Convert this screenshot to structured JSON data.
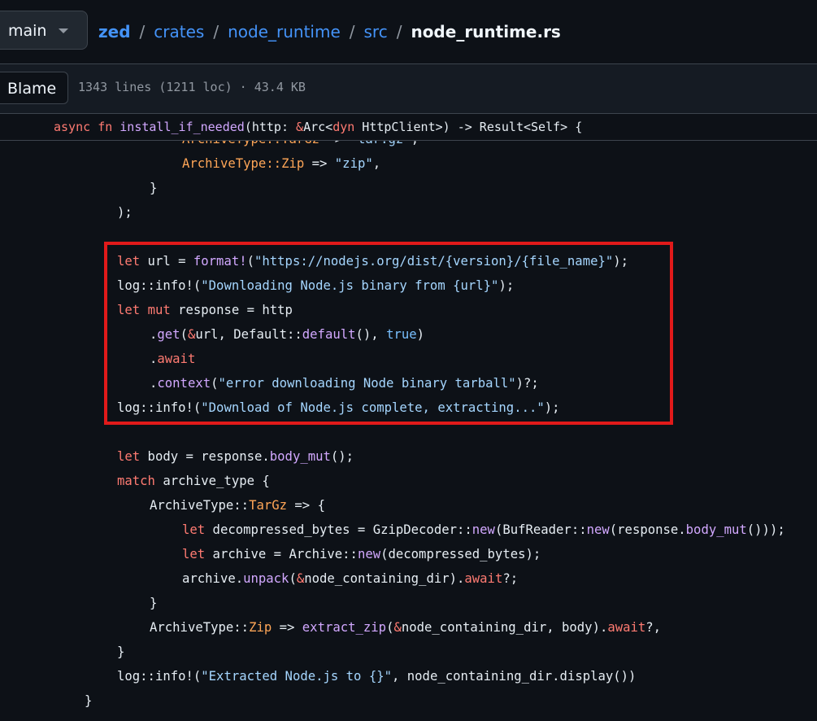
{
  "header": {
    "branch": "main",
    "breadcrumb": [
      "zed",
      "crates",
      "node_runtime",
      "src"
    ],
    "separator": "/",
    "current_file": "node_runtime.rs"
  },
  "infobar": {
    "blame_label": "Blame",
    "file_meta": "1343 lines (1211 loc) · 43.4 KB"
  },
  "code": {
    "sticky_header": [
      {
        "t": "async",
        "c": "kw"
      },
      {
        "t": " "
      },
      {
        "t": "fn",
        "c": "kw"
      },
      {
        "t": " "
      },
      {
        "t": "install_if_needed",
        "c": "fn"
      },
      {
        "t": "(http: "
      },
      {
        "t": "&",
        "c": "kw"
      },
      {
        "t": "Arc<"
      },
      {
        "t": "dyn",
        "c": "kw"
      },
      {
        "t": " HttpClient>) -> Result<Self> {"
      }
    ],
    "lines": [
      {
        "indent": 56,
        "spans": [
          {
            "t": "ArchiveType::",
            "c": "ty"
          },
          {
            "t": "TarGz",
            "c": "ty"
          },
          {
            "t": " => "
          },
          {
            "t": "\"tar.gz\"",
            "c": "str"
          },
          {
            "t": ","
          }
        ]
      },
      {
        "indent": 56,
        "spans": [
          {
            "t": "ArchiveType::",
            "c": "ty"
          },
          {
            "t": "Zip",
            "c": "ty"
          },
          {
            "t": " => "
          },
          {
            "t": "\"zip\"",
            "c": "str"
          },
          {
            "t": ","
          }
        ]
      },
      {
        "indent": 46,
        "spans": [
          {
            "t": "}"
          }
        ]
      },
      {
        "indent": 36,
        "spans": [
          {
            "t": ");"
          }
        ]
      },
      {
        "indent": 0,
        "spans": []
      },
      {
        "indent": 36,
        "spans": [
          {
            "t": "let",
            "c": "kw"
          },
          {
            "t": " url = "
          },
          {
            "t": "format!",
            "c": "fn"
          },
          {
            "t": "("
          },
          {
            "t": "\"https://nodejs.org/dist/{version}/{file_name}\"",
            "c": "str"
          },
          {
            "t": ");"
          }
        ]
      },
      {
        "indent": 36,
        "spans": [
          {
            "t": "log::info!("
          },
          {
            "t": "\"Downloading Node.js binary from {url}\"",
            "c": "str"
          },
          {
            "t": ");"
          }
        ]
      },
      {
        "indent": 36,
        "spans": [
          {
            "t": "let",
            "c": "kw"
          },
          {
            "t": " "
          },
          {
            "t": "mut",
            "c": "kw"
          },
          {
            "t": " response = http"
          }
        ]
      },
      {
        "indent": 46,
        "spans": [
          {
            "t": "."
          },
          {
            "t": "get",
            "c": "fn"
          },
          {
            "t": "("
          },
          {
            "t": "&",
            "c": "kw"
          },
          {
            "t": "url, Default::"
          },
          {
            "t": "default",
            "c": "fn"
          },
          {
            "t": "(), "
          },
          {
            "t": "true",
            "c": "lit"
          },
          {
            "t": ")"
          }
        ]
      },
      {
        "indent": 46,
        "spans": [
          {
            "t": "."
          },
          {
            "t": "await",
            "c": "kw"
          }
        ]
      },
      {
        "indent": 46,
        "spans": [
          {
            "t": "."
          },
          {
            "t": "context",
            "c": "fn"
          },
          {
            "t": "("
          },
          {
            "t": "\"error downloading Node binary tarball\"",
            "c": "str"
          },
          {
            "t": ")?;"
          }
        ]
      },
      {
        "indent": 36,
        "spans": [
          {
            "t": "log::info!("
          },
          {
            "t": "\"Download of Node.js complete, extracting...\"",
            "c": "str"
          },
          {
            "t": ");"
          }
        ]
      },
      {
        "indent": 0,
        "spans": []
      },
      {
        "indent": 36,
        "spans": [
          {
            "t": "let",
            "c": "kw"
          },
          {
            "t": " body = response."
          },
          {
            "t": "body_mut",
            "c": "fn"
          },
          {
            "t": "();"
          }
        ]
      },
      {
        "indent": 36,
        "spans": [
          {
            "t": "match",
            "c": "kw"
          },
          {
            "t": " archive_type {"
          }
        ]
      },
      {
        "indent": 46,
        "spans": [
          {
            "t": "ArchiveType::"
          },
          {
            "t": "TarGz",
            "c": "ty"
          },
          {
            "t": " => {"
          }
        ]
      },
      {
        "indent": 56,
        "spans": [
          {
            "t": "let",
            "c": "kw"
          },
          {
            "t": " decompressed_bytes = GzipDecoder::"
          },
          {
            "t": "new",
            "c": "fn"
          },
          {
            "t": "(BufReader::"
          },
          {
            "t": "new",
            "c": "fn"
          },
          {
            "t": "(response."
          },
          {
            "t": "body_mut",
            "c": "fn"
          },
          {
            "t": "()));"
          }
        ]
      },
      {
        "indent": 56,
        "spans": [
          {
            "t": "let",
            "c": "kw"
          },
          {
            "t": " archive = Archive::"
          },
          {
            "t": "new",
            "c": "fn"
          },
          {
            "t": "(decompressed_bytes);"
          }
        ]
      },
      {
        "indent": 56,
        "spans": [
          {
            "t": "archive."
          },
          {
            "t": "unpack",
            "c": "fn"
          },
          {
            "t": "("
          },
          {
            "t": "&",
            "c": "kw"
          },
          {
            "t": "node_containing_dir)."
          },
          {
            "t": "await",
            "c": "kw"
          },
          {
            "t": "?;"
          }
        ]
      },
      {
        "indent": 46,
        "spans": [
          {
            "t": "}"
          }
        ]
      },
      {
        "indent": 46,
        "spans": [
          {
            "t": "ArchiveType::"
          },
          {
            "t": "Zip",
            "c": "ty"
          },
          {
            "t": " => "
          },
          {
            "t": "extract_zip",
            "c": "fn"
          },
          {
            "t": "("
          },
          {
            "t": "&",
            "c": "kw"
          },
          {
            "t": "node_containing_dir, body)."
          },
          {
            "t": "await",
            "c": "kw"
          },
          {
            "t": "?,"
          }
        ]
      },
      {
        "indent": 36,
        "spans": [
          {
            "t": "}"
          }
        ]
      },
      {
        "indent": 36,
        "spans": [
          {
            "t": "log::info!("
          },
          {
            "t": "\"Extracted Node.js to {}\"",
            "c": "str"
          },
          {
            "t": ", node_containing_dir.display())"
          }
        ]
      },
      {
        "indent": 26,
        "spans": [
          {
            "t": "}"
          }
        ]
      }
    ]
  },
  "colors": {
    "background": "#0d1117",
    "keyword": "#ff7b72",
    "function": "#d2a8ff",
    "string": "#a5d6ff",
    "type": "#ffa657",
    "literal": "#79c0ff",
    "highlight_box": "#e11a1a",
    "link": "#4493f8"
  }
}
